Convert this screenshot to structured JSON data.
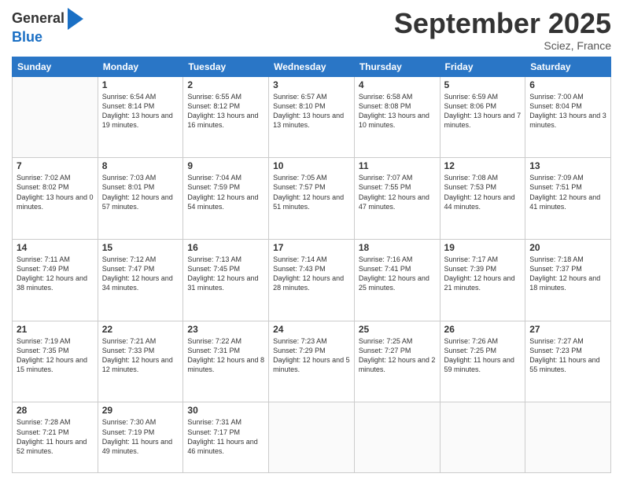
{
  "header": {
    "logo_line1": "General",
    "logo_line2": "Blue",
    "month": "September 2025",
    "location": "Sciez, France"
  },
  "days_of_week": [
    "Sunday",
    "Monday",
    "Tuesday",
    "Wednesday",
    "Thursday",
    "Friday",
    "Saturday"
  ],
  "weeks": [
    [
      {
        "day": "",
        "sunrise": "",
        "sunset": "",
        "daylight": ""
      },
      {
        "day": "1",
        "sunrise": "Sunrise: 6:54 AM",
        "sunset": "Sunset: 8:14 PM",
        "daylight": "Daylight: 13 hours and 19 minutes."
      },
      {
        "day": "2",
        "sunrise": "Sunrise: 6:55 AM",
        "sunset": "Sunset: 8:12 PM",
        "daylight": "Daylight: 13 hours and 16 minutes."
      },
      {
        "day": "3",
        "sunrise": "Sunrise: 6:57 AM",
        "sunset": "Sunset: 8:10 PM",
        "daylight": "Daylight: 13 hours and 13 minutes."
      },
      {
        "day": "4",
        "sunrise": "Sunrise: 6:58 AM",
        "sunset": "Sunset: 8:08 PM",
        "daylight": "Daylight: 13 hours and 10 minutes."
      },
      {
        "day": "5",
        "sunrise": "Sunrise: 6:59 AM",
        "sunset": "Sunset: 8:06 PM",
        "daylight": "Daylight: 13 hours and 7 minutes."
      },
      {
        "day": "6",
        "sunrise": "Sunrise: 7:00 AM",
        "sunset": "Sunset: 8:04 PM",
        "daylight": "Daylight: 13 hours and 3 minutes."
      }
    ],
    [
      {
        "day": "7",
        "sunrise": "Sunrise: 7:02 AM",
        "sunset": "Sunset: 8:02 PM",
        "daylight": "Daylight: 13 hours and 0 minutes."
      },
      {
        "day": "8",
        "sunrise": "Sunrise: 7:03 AM",
        "sunset": "Sunset: 8:01 PM",
        "daylight": "Daylight: 12 hours and 57 minutes."
      },
      {
        "day": "9",
        "sunrise": "Sunrise: 7:04 AM",
        "sunset": "Sunset: 7:59 PM",
        "daylight": "Daylight: 12 hours and 54 minutes."
      },
      {
        "day": "10",
        "sunrise": "Sunrise: 7:05 AM",
        "sunset": "Sunset: 7:57 PM",
        "daylight": "Daylight: 12 hours and 51 minutes."
      },
      {
        "day": "11",
        "sunrise": "Sunrise: 7:07 AM",
        "sunset": "Sunset: 7:55 PM",
        "daylight": "Daylight: 12 hours and 47 minutes."
      },
      {
        "day": "12",
        "sunrise": "Sunrise: 7:08 AM",
        "sunset": "Sunset: 7:53 PM",
        "daylight": "Daylight: 12 hours and 44 minutes."
      },
      {
        "day": "13",
        "sunrise": "Sunrise: 7:09 AM",
        "sunset": "Sunset: 7:51 PM",
        "daylight": "Daylight: 12 hours and 41 minutes."
      }
    ],
    [
      {
        "day": "14",
        "sunrise": "Sunrise: 7:11 AM",
        "sunset": "Sunset: 7:49 PM",
        "daylight": "Daylight: 12 hours and 38 minutes."
      },
      {
        "day": "15",
        "sunrise": "Sunrise: 7:12 AM",
        "sunset": "Sunset: 7:47 PM",
        "daylight": "Daylight: 12 hours and 34 minutes."
      },
      {
        "day": "16",
        "sunrise": "Sunrise: 7:13 AM",
        "sunset": "Sunset: 7:45 PM",
        "daylight": "Daylight: 12 hours and 31 minutes."
      },
      {
        "day": "17",
        "sunrise": "Sunrise: 7:14 AM",
        "sunset": "Sunset: 7:43 PM",
        "daylight": "Daylight: 12 hours and 28 minutes."
      },
      {
        "day": "18",
        "sunrise": "Sunrise: 7:16 AM",
        "sunset": "Sunset: 7:41 PM",
        "daylight": "Daylight: 12 hours and 25 minutes."
      },
      {
        "day": "19",
        "sunrise": "Sunrise: 7:17 AM",
        "sunset": "Sunset: 7:39 PM",
        "daylight": "Daylight: 12 hours and 21 minutes."
      },
      {
        "day": "20",
        "sunrise": "Sunrise: 7:18 AM",
        "sunset": "Sunset: 7:37 PM",
        "daylight": "Daylight: 12 hours and 18 minutes."
      }
    ],
    [
      {
        "day": "21",
        "sunrise": "Sunrise: 7:19 AM",
        "sunset": "Sunset: 7:35 PM",
        "daylight": "Daylight: 12 hours and 15 minutes."
      },
      {
        "day": "22",
        "sunrise": "Sunrise: 7:21 AM",
        "sunset": "Sunset: 7:33 PM",
        "daylight": "Daylight: 12 hours and 12 minutes."
      },
      {
        "day": "23",
        "sunrise": "Sunrise: 7:22 AM",
        "sunset": "Sunset: 7:31 PM",
        "daylight": "Daylight: 12 hours and 8 minutes."
      },
      {
        "day": "24",
        "sunrise": "Sunrise: 7:23 AM",
        "sunset": "Sunset: 7:29 PM",
        "daylight": "Daylight: 12 hours and 5 minutes."
      },
      {
        "day": "25",
        "sunrise": "Sunrise: 7:25 AM",
        "sunset": "Sunset: 7:27 PM",
        "daylight": "Daylight: 12 hours and 2 minutes."
      },
      {
        "day": "26",
        "sunrise": "Sunrise: 7:26 AM",
        "sunset": "Sunset: 7:25 PM",
        "daylight": "Daylight: 11 hours and 59 minutes."
      },
      {
        "day": "27",
        "sunrise": "Sunrise: 7:27 AM",
        "sunset": "Sunset: 7:23 PM",
        "daylight": "Daylight: 11 hours and 55 minutes."
      }
    ],
    [
      {
        "day": "28",
        "sunrise": "Sunrise: 7:28 AM",
        "sunset": "Sunset: 7:21 PM",
        "daylight": "Daylight: 11 hours and 52 minutes."
      },
      {
        "day": "29",
        "sunrise": "Sunrise: 7:30 AM",
        "sunset": "Sunset: 7:19 PM",
        "daylight": "Daylight: 11 hours and 49 minutes."
      },
      {
        "day": "30",
        "sunrise": "Sunrise: 7:31 AM",
        "sunset": "Sunset: 7:17 PM",
        "daylight": "Daylight: 11 hours and 46 minutes."
      },
      {
        "day": "",
        "sunrise": "",
        "sunset": "",
        "daylight": ""
      },
      {
        "day": "",
        "sunrise": "",
        "sunset": "",
        "daylight": ""
      },
      {
        "day": "",
        "sunrise": "",
        "sunset": "",
        "daylight": ""
      },
      {
        "day": "",
        "sunrise": "",
        "sunset": "",
        "daylight": ""
      }
    ]
  ]
}
